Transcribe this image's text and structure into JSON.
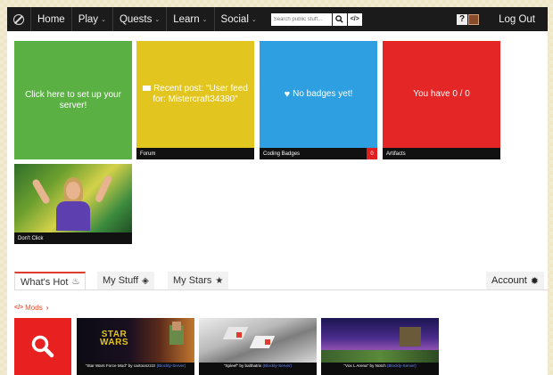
{
  "nav": {
    "items": [
      {
        "label": "Home"
      },
      {
        "label": "Play",
        "dropdown": true
      },
      {
        "label": "Quests",
        "dropdown": true
      },
      {
        "label": "Learn",
        "dropdown": true
      },
      {
        "label": "Social",
        "dropdown": true
      }
    ],
    "search_placeholder": "Search public stuff...",
    "logout_label": "Log Out"
  },
  "tiles": {
    "server": {
      "text": "Click here to set up your server!",
      "color": "#5bb043"
    },
    "forum": {
      "text": "Recent post: \"User feed for: Mistercraft34380\"",
      "caption": "Forum",
      "color": "#e3c51f"
    },
    "badges": {
      "text": "No badges yet!",
      "caption": "Coding Badges",
      "count": "0",
      "color": "#2e9fe0"
    },
    "artifacts": {
      "text": "You have 0 / 0",
      "caption": "Artifacts",
      "color": "#e52626"
    },
    "video": {
      "caption": "Don't Click"
    }
  },
  "tabs": [
    {
      "label": "What's Hot",
      "icon": "flame-icon",
      "active": true
    },
    {
      "label": "My Stuff",
      "icon": "cube-icon",
      "active": false
    },
    {
      "label": "My Stars",
      "icon": "star-icon",
      "active": false
    }
  ],
  "account_label": "Account",
  "mods": {
    "label": "Mods",
    "cards": [
      {
        "title": "\"Star Wars Force Mod\" by cartoonzzzz",
        "server": "(Blockly-Server)",
        "logo": "STAR WARS"
      },
      {
        "title": "\"Spleef\" by balthatrix",
        "server": "(Blockly-Server)"
      },
      {
        "title": "\"Vox L Arena\" by Notch",
        "server": "(Blockly-Server)"
      }
    ]
  },
  "colors": {
    "accent": "#e03c2c",
    "nav_bg": "#1b1b1b"
  }
}
